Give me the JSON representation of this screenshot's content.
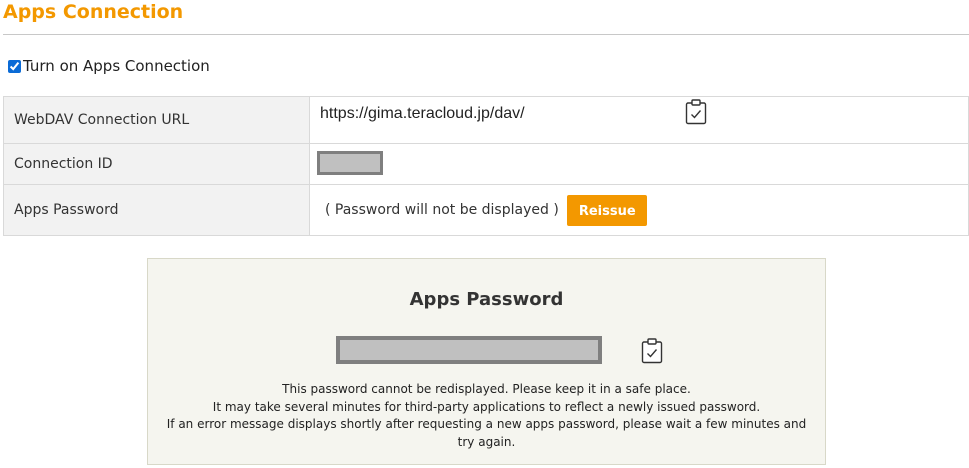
{
  "section": {
    "title": "Apps Connection"
  },
  "toggle": {
    "label": "Turn on Apps Connection",
    "checked": true
  },
  "table": {
    "url_label": "WebDAV Connection URL",
    "url_value": "https://gima.teracloud.jp/dav/",
    "id_label": "Connection ID",
    "password_label": "Apps Password",
    "password_note": "( Password will not be displayed )",
    "reissue_label": "Reissue"
  },
  "panel": {
    "title": "Apps Password",
    "notes": [
      "This password cannot be redisplayed. Please keep it in a safe place.",
      "It may take several minutes for third-party applications to reflect a newly issued password.",
      "If an error message displays shortly after requesting a new apps password, please wait a few minutes and try again."
    ]
  },
  "icons": {
    "copy_url": "clipboard-check-icon",
    "copy_password": "clipboard-check-icon"
  },
  "colors": {
    "accent": "#f39800",
    "panel_bg": "#f5f5ef",
    "label_bg": "#f2f2f2",
    "mask_fill": "#c0c0c0",
    "mask_border": "#7f7f7f"
  }
}
